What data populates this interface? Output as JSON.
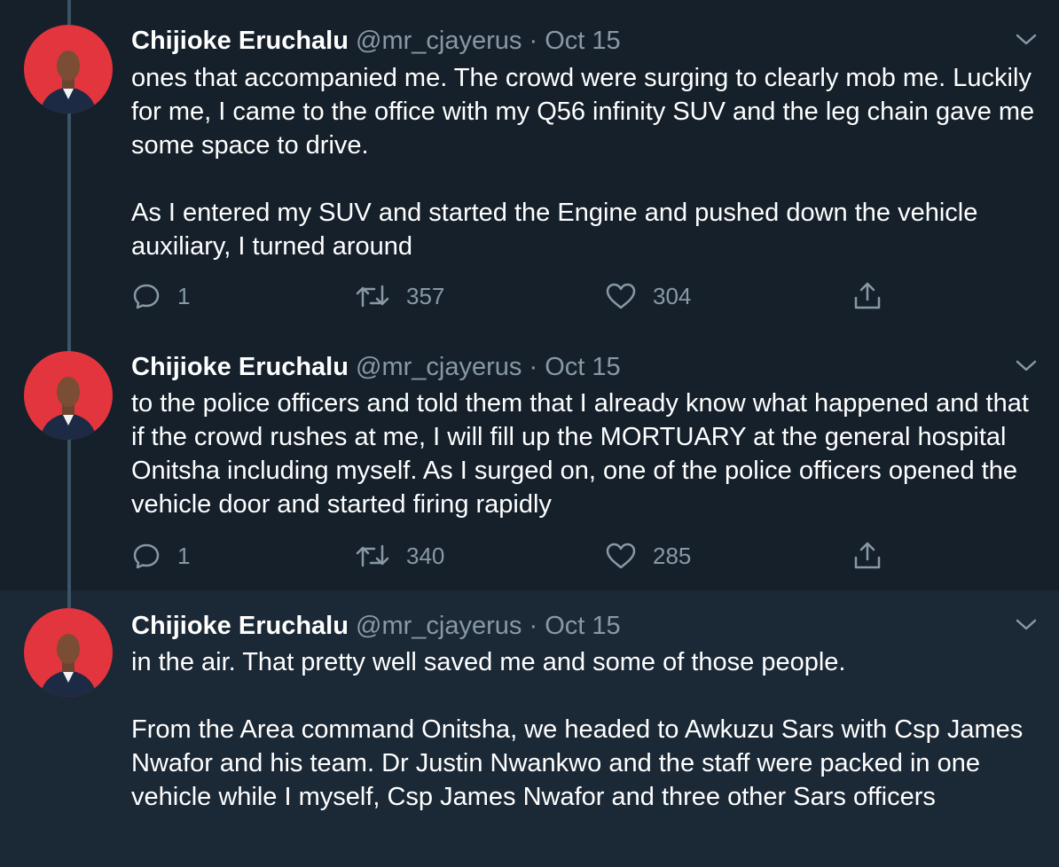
{
  "tweets": [
    {
      "author_name": "Chijioke Eruchalu",
      "handle": "@mr_cjayerus",
      "separator": "·",
      "date": "Oct 15",
      "text": "ones that accompanied me. The crowd were surging to clearly mob me. Luckily for me, I came to the office with my Q56 infinity SUV and the leg chain gave me some space to drive.\n\nAs I entered my SUV and started the Engine and pushed  down the vehicle auxiliary, I turned around",
      "replies": "1",
      "retweets": "357",
      "likes": "304"
    },
    {
      "author_name": "Chijioke Eruchalu",
      "handle": "@mr_cjayerus",
      "separator": "·",
      "date": "Oct 15",
      "text": "to the police officers and told them that I already know what happened and that if the crowd rushes at me, I will fill up the MORTUARY at the general hospital Onitsha including myself. As I surged on, one of the police officers opened the vehicle door and started firing rapidly",
      "replies": "1",
      "retweets": "340",
      "likes": "285"
    },
    {
      "author_name": "Chijioke Eruchalu",
      "handle": "@mr_cjayerus",
      "separator": "·",
      "date": "Oct 15",
      "text": "in the air. That pretty well saved me and some of those people.\n\nFrom the Area command Onitsha, we headed to Awkuzu Sars with Csp James Nwafor and his team. Dr Justin Nwankwo and the staff were packed in one vehicle while I myself, Csp James Nwafor and three other Sars officers"
    }
  ],
  "colors": {
    "background": "#15202b",
    "highlight_background": "#1b2836",
    "secondary_text": "#8899a6",
    "thread_line": "#3d5466",
    "avatar_background": "#e3353d"
  },
  "icons": [
    "reply-icon",
    "retweet-icon",
    "like-icon",
    "share-icon",
    "chevron-down-icon",
    "avatar"
  ]
}
